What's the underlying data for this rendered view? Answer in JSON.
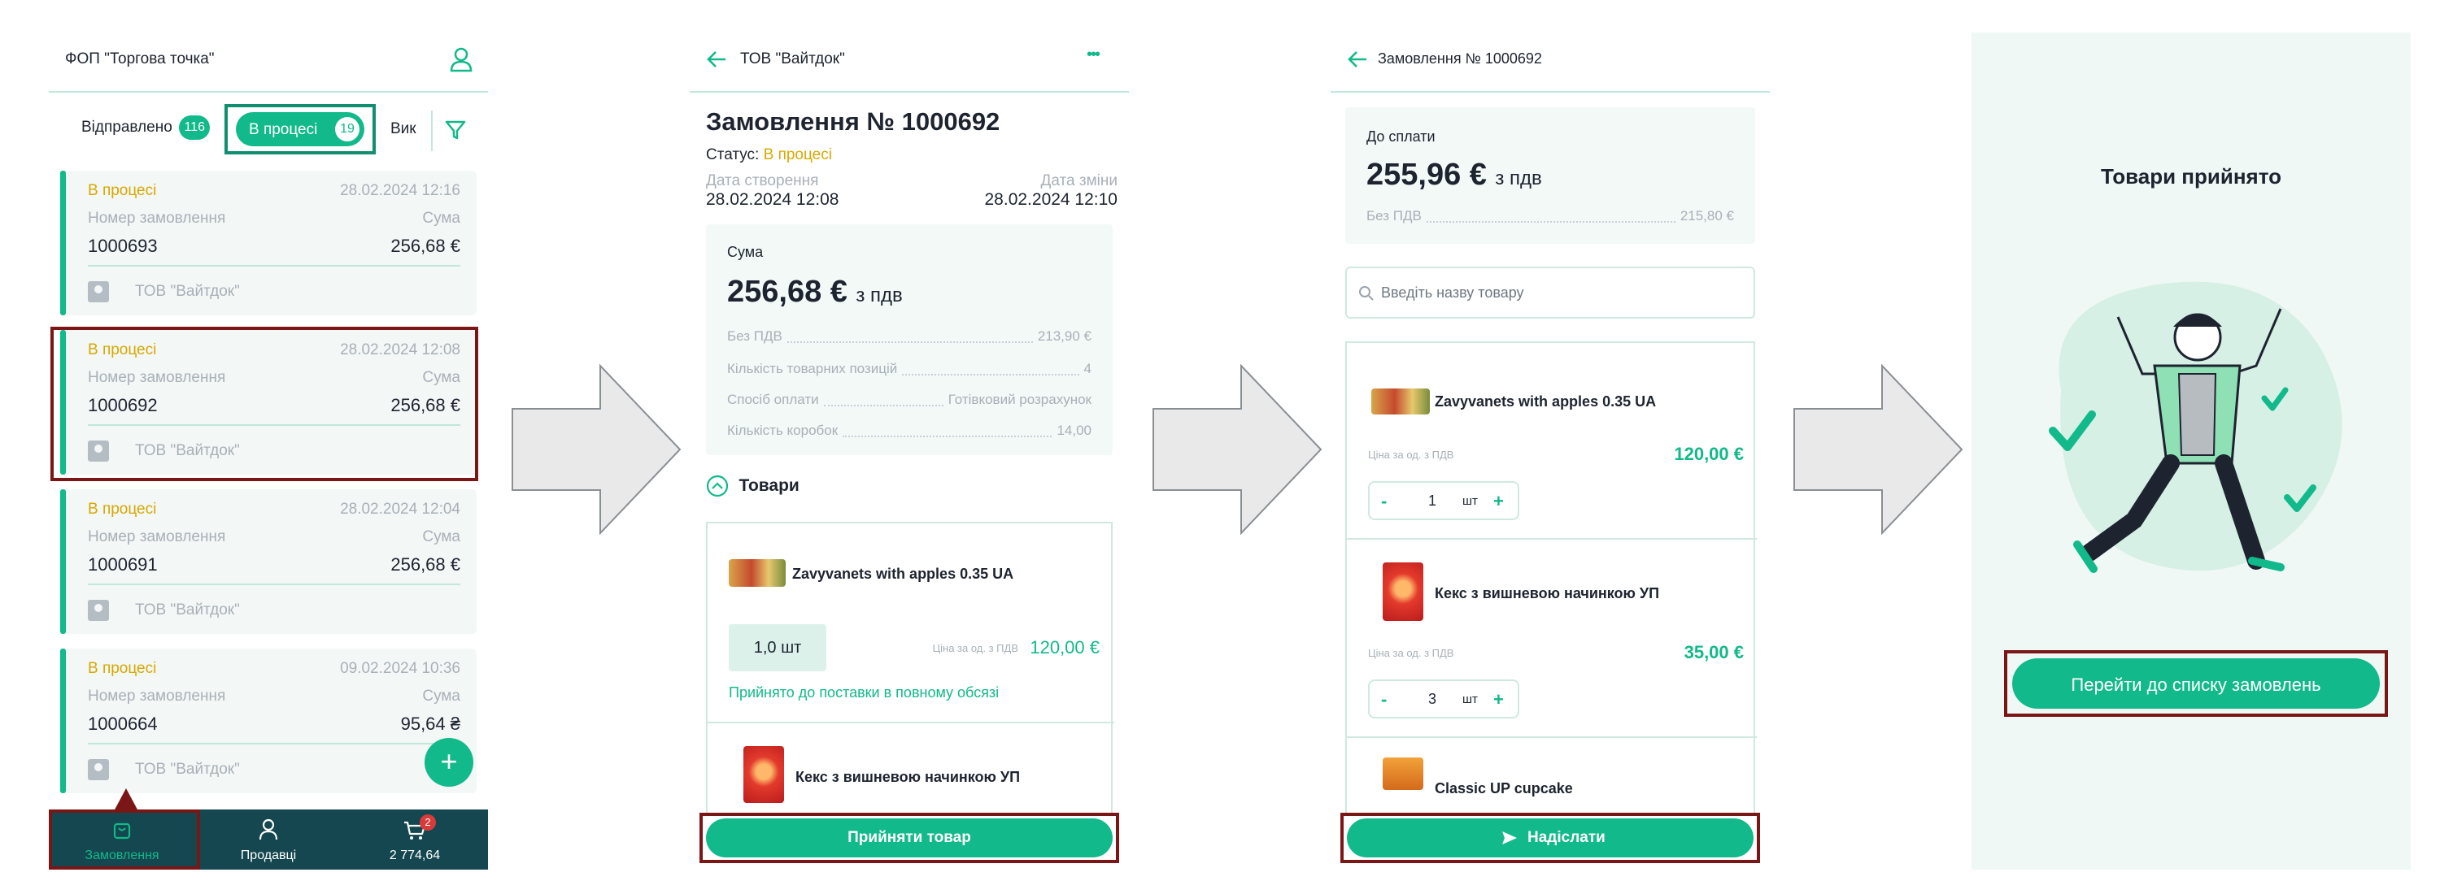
{
  "screen1": {
    "shop_title": "ФОП \"Торгова точка\"",
    "tabs": [
      {
        "label": "Відправлено",
        "count": "116"
      },
      {
        "label": "В процесі",
        "count": "19"
      },
      {
        "label": "Вик"
      }
    ],
    "orders": [
      {
        "status": "В процесі",
        "date": "28.02.2024 12:16",
        "num_label": "Номер замовлення",
        "sum_label": "Сума",
        "number": "1000693",
        "sum": "256,68 €",
        "vendor": "ТОВ \"Вайтдок\""
      },
      {
        "status": "В процесі",
        "date": "28.02.2024 12:08",
        "num_label": "Номер замовлення",
        "sum_label": "Сума",
        "number": "1000692",
        "sum": "256,68 €",
        "vendor": "ТОВ \"Вайтдок\""
      },
      {
        "status": "В процесі",
        "date": "28.02.2024 12:04",
        "num_label": "Номер замовлення",
        "sum_label": "Сума",
        "number": "1000691",
        "sum": "256,68 €",
        "vendor": "ТОВ \"Вайтдок\""
      },
      {
        "status": "В процесі",
        "date": "09.02.2024 10:36",
        "num_label": "Номер замовлення",
        "sum_label": "Сума",
        "number": "1000664",
        "sum": "95,64 ₴",
        "vendor": "ТОВ \"Вайтдок\""
      }
    ],
    "fab_symbol": "+",
    "nav": [
      {
        "label": "Замовлення"
      },
      {
        "label": "Продавці"
      },
      {
        "label": "2 774,64",
        "badge": "2"
      }
    ]
  },
  "screen2": {
    "header_title": "ТОВ \"Вайтдок\"",
    "menu_icon": "•••",
    "order_title": "Замовлення № 1000692",
    "status_label": "Статус:",
    "status_value": "В процесі",
    "created_label": "Дата створення",
    "created_value": "28.02.2024 12:08",
    "changed_label": "Дата зміни",
    "changed_value": "28.02.2024 12:10",
    "sum_label": "Сума",
    "sum_value": "256,68 €",
    "sum_suffix": "з пдв",
    "details": [
      {
        "label": "Без ПДВ",
        "value": "213,90 €"
      },
      {
        "label": "Кількість товарних позицій",
        "value": "4"
      },
      {
        "label": "Спосіб оплати",
        "value": "Готівковий розрахунок"
      },
      {
        "label": "Кількість коробок",
        "value": "14,00"
      }
    ],
    "goods_label": "Товари",
    "product1": {
      "name": "Zavyvanets with apples 0.35 UA",
      "qty": "1,0 шт",
      "price_label": "Ціна за од. з ПДВ",
      "price": "120,00 €",
      "accepted_note": "Прийнято до поставки в повному обсязі"
    },
    "product2": {
      "name": "Кекс з вишневою начинкою УП"
    },
    "accept_button": "Прийняти товар"
  },
  "screen3": {
    "header_title": "Замовлення № 1000692",
    "pay_label": "До сплати",
    "pay_value": "255,96 €",
    "pay_suffix": "з пдв",
    "no_vat_label": "Без ПДВ",
    "no_vat_value": "215,80 €",
    "search_placeholder": "Введіть назву товару",
    "products": [
      {
        "name": "Zavyvanets with apples 0.35 UA",
        "price_label": "Ціна за од. з ПДВ",
        "price": "120,00 €",
        "minus": "-",
        "qty": "1",
        "unit": "шт",
        "plus": "+"
      },
      {
        "name": "Кекс з вишневою начинкою УП",
        "price_label": "Ціна за од. з ПДВ",
        "price": "35,00 €",
        "minus": "-",
        "qty": "3",
        "unit": "шт",
        "plus": "+"
      }
    ],
    "product3_name": "Classic UP cupcake",
    "send_button": "Надіслати"
  },
  "screen4": {
    "title": "Товари прийнято",
    "go_button": "Перейти до списку замовлень"
  },
  "colors": {
    "accent": "#12b98a",
    "status": "#d9a800",
    "highlight": "#7a1616",
    "nav_bg": "#14474f"
  }
}
